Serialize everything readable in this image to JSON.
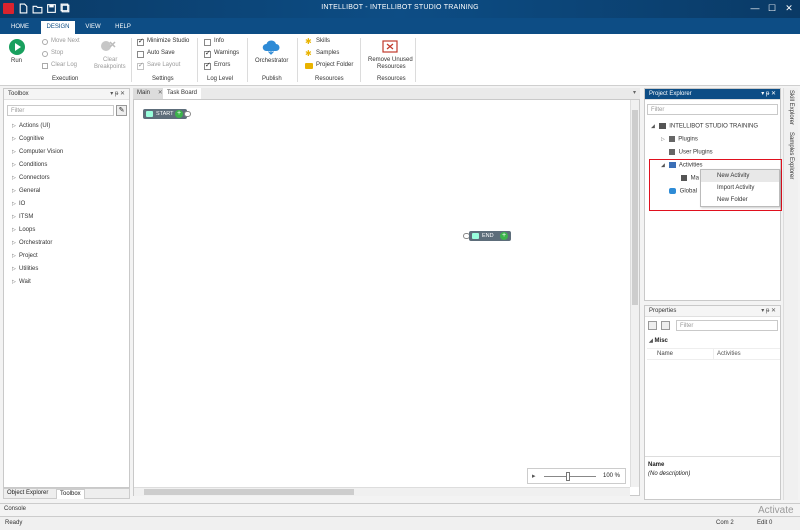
{
  "window": {
    "title": "INTELLIBOT - INTELLIBOT STUDIO TRAINING",
    "minimize": "—",
    "maximize": "☐",
    "close": "✕"
  },
  "ribbon_tabs": [
    "HOME",
    "DESIGN",
    "VIEW",
    "HELP"
  ],
  "ribbon": {
    "run": "Run",
    "move_next": "Move Next",
    "stop": "Stop",
    "clear_log": "Clear Log",
    "clear_breakpoints_1": "Clear",
    "clear_breakpoints_2": "Breakpoints",
    "execution": "Execution",
    "minimize_studio": "Minimize Studio",
    "auto_save": "Auto Save",
    "save_layout": "Save Layout",
    "settings": "Settings",
    "info": "Info",
    "warnings": "Warnings",
    "errors": "Errors",
    "log_level": "Log Level",
    "orchestrator": "Orchestrator",
    "publish": "Publish",
    "skills": "Skills",
    "samples": "Samples",
    "project_folder": "Project Folder",
    "resources": "Resources",
    "remove_unused_1": "Remove Unused",
    "remove_unused_2": "Resources",
    "resources2": "Resources"
  },
  "toolbox": {
    "title": "Toolbox",
    "pin": "▾ ᵽ ✕",
    "filter_placeholder": "Filter",
    "items": [
      "Actions (UI)",
      "Cognitive",
      "Computer Vision",
      "Conditions",
      "Connectors",
      "General",
      "IO",
      "ITSM",
      "Loops",
      "Orchestrator",
      "Project",
      "Utilities",
      "Wait"
    ],
    "bottom_tabs": [
      "Object Explorer",
      "Toolbox"
    ]
  },
  "doc_tabs": {
    "main": "Main",
    "close": "✕",
    "task_board": "Task Board",
    "menu": "▾"
  },
  "canvas": {
    "start": "START",
    "end": "END",
    "plus": "+",
    "zoom": "100 %",
    "play": "▸"
  },
  "project_explorer": {
    "title": "Project Explorer",
    "controls": "▾ ᵽ ✕",
    "filter_placeholder": "Filter",
    "root": "INTELLIBOT STUDIO TRAINING",
    "plugins": "Plugins",
    "user_plugins": "User Plugins",
    "activities": "Activities",
    "main_partial": "Ma",
    "global_partial": "Global"
  },
  "context_menu": [
    "New Activity",
    "Import Activity",
    "New Folder"
  ],
  "properties": {
    "title": "Properties",
    "controls": "▾ ᵽ ✕",
    "filter_placeholder": "Filter",
    "section": "Misc",
    "rows": [
      {
        "name": "Name",
        "value": "Activities"
      }
    ],
    "desc_title": "Name",
    "desc_text": "(No description)"
  },
  "side_tabs": [
    "Skill Explorer",
    "Samples Explorer"
  ],
  "console": "Console",
  "status": {
    "left": "Ready",
    "com": "Com 2",
    "col": "Edit 0",
    "watermark": "Activate"
  },
  "colors": {
    "accent": "#0d4d85",
    "highlight_box": "#e0101e",
    "run_green": "#18a05e"
  }
}
